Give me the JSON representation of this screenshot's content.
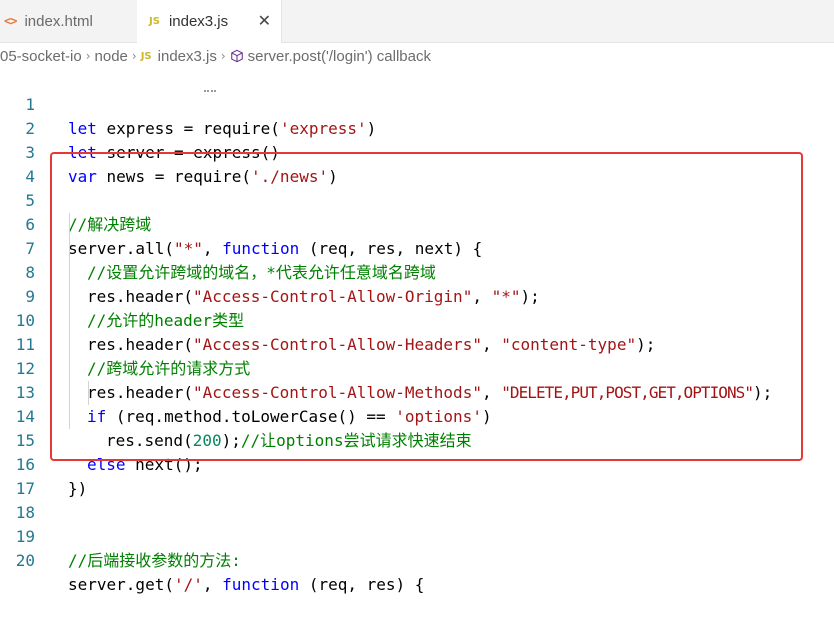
{
  "tabs": [
    {
      "icon": "<>",
      "label": "index.html",
      "active": false
    },
    {
      "icon": "JS",
      "label": "index3.js",
      "active": true,
      "close": "✕"
    }
  ],
  "breadcrumb": {
    "items": [
      "05-socket-io",
      "node",
      "index3.js",
      "server.post('/login') callback"
    ],
    "separator": "›",
    "js_badge": "JS"
  },
  "colors": {
    "keyword": "#0000ff",
    "string": "#a31515",
    "comment": "#008000",
    "number": "#098658",
    "line_number": "#237893",
    "highlight_border": "#e53935"
  },
  "code": {
    "line_numbers": [
      "1",
      "2",
      "3",
      "4",
      "5",
      "6",
      "7",
      "8",
      "9",
      "10",
      "11",
      "12",
      "13",
      "14",
      "15",
      "16",
      "17",
      "18",
      "19",
      "20"
    ],
    "l1": {
      "kw": "let",
      "a": " express = require(",
      "s": "'express'",
      "b": ")"
    },
    "l2": {
      "kw": "let",
      "a": " server = express()"
    },
    "l3": {
      "kw": "var",
      "a": " news = require(",
      "s": "'./news'",
      "b": ")"
    },
    "l5": {
      "cm": "//解决跨域"
    },
    "l6": {
      "a": "server.all(",
      "s": "\"*\"",
      "b": ", ",
      "kw": "function",
      "c": " (req, res, next) {"
    },
    "l7": {
      "cm": "//设置允许跨域的域名，*代表允许任意域名跨域"
    },
    "l8": {
      "a": "res.header(",
      "s1": "\"Access-Control-Allow-Origin\"",
      "b": ", ",
      "s2": "\"*\"",
      "c": ");"
    },
    "l9": {
      "cm": "//允许的header类型"
    },
    "l10": {
      "a": "res.header(",
      "s1": "\"Access-Control-Allow-Headers\"",
      "b": ", ",
      "s2": "\"content-type\"",
      "c": ");"
    },
    "l11": {
      "cm": "//跨域允许的请求方式"
    },
    "l12": {
      "a": "res.header(",
      "s1": "\"Access-Control-Allow-Methods\"",
      "b": ", ",
      "s2": "\"DELETE,PUT,POST,GET,OPTIONS\"",
      "c": ");"
    },
    "l13": {
      "kw": "if",
      "a": " (req.method.toLowerCase() == ",
      "s": "'options'",
      "b": ")"
    },
    "l14": {
      "a": "res.send(",
      "num": "200",
      "b": ");",
      "cm": "//让options尝试请求快速结束"
    },
    "l15": {
      "kw": "else",
      "a": " next();"
    },
    "l16": {
      "a": "})"
    },
    "l19": {
      "cm": "//后端接收参数的方法:"
    },
    "l20": {
      "a": "server.get(",
      "s": "'/'",
      "b": ", ",
      "kw": "function",
      "c": " (req, res) {"
    }
  }
}
